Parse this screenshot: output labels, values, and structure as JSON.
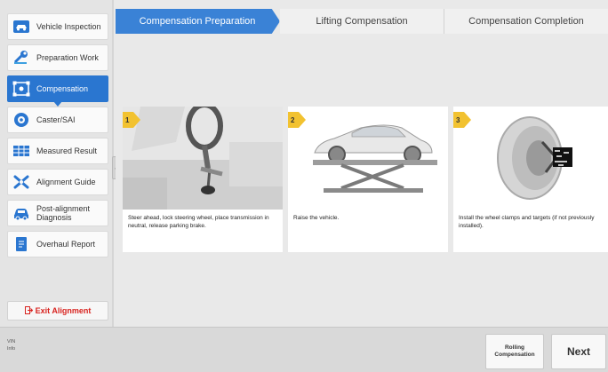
{
  "sidebar": {
    "items": [
      {
        "label": "Vehicle Inspection",
        "icon": "car-inspection-icon"
      },
      {
        "label": "Preparation Work",
        "icon": "wrench-icon"
      },
      {
        "label": "Compensation",
        "icon": "compensation-icon"
      },
      {
        "label": "Caster/SAI",
        "icon": "wheel-icon"
      },
      {
        "label": "Measured Result",
        "icon": "table-icon"
      },
      {
        "label": "Alignment Guide",
        "icon": "tools-icon"
      },
      {
        "label": "Post-alignment Diagnosis",
        "icon": "car-diagnosis-icon"
      },
      {
        "label": "Overhaul Report",
        "icon": "report-icon"
      }
    ],
    "exit_label": "Exit Alignment"
  },
  "tabs": [
    {
      "label": "Compensation Preparation",
      "active": true
    },
    {
      "label": "Lifting Compensation",
      "active": false
    },
    {
      "label": "Compensation Completion",
      "active": false
    }
  ],
  "steps": [
    {
      "number": "1",
      "text": "Steer ahead, lock steering wheel, place transmission in neutral, release parking brake."
    },
    {
      "number": "2",
      "text": "Raise the vehicle."
    },
    {
      "number": "3",
      "text": "Install the wheel clamps and targets (if not previously installed)."
    }
  ],
  "footer": {
    "vin_label": "VIN",
    "info_label": "Info",
    "rolling_label_1": "Rolling",
    "rolling_label_2": "Compensation",
    "next_label": "Next"
  },
  "colors": {
    "accent": "#2a76d0",
    "tab_active": "#3a82d6",
    "exit": "#d8231f",
    "badge": "#f2c230"
  }
}
